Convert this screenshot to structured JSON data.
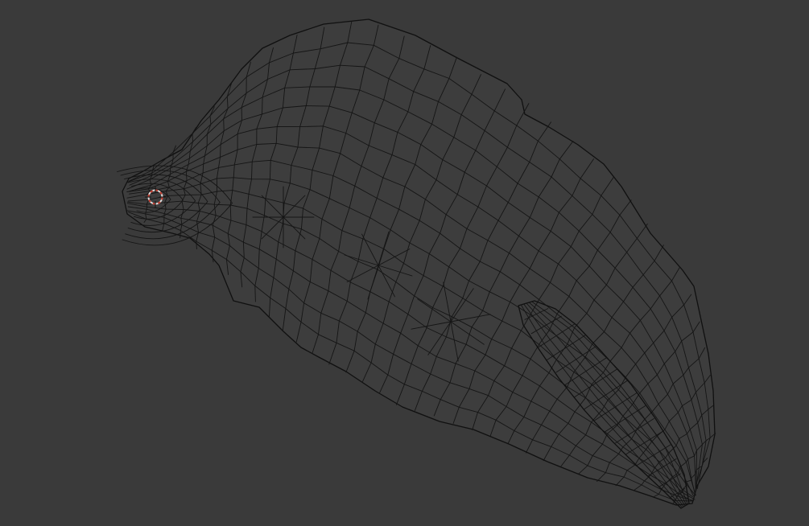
{
  "viewport": {
    "background_color": "#3a3a3a",
    "wire_color": "#151515",
    "cursor_colors": {
      "primary": "#d9d9d9",
      "secondary": "#c0392b"
    },
    "object_name": "mesh-wireframe",
    "cursor_icon": "3d-cursor-icon"
  }
}
